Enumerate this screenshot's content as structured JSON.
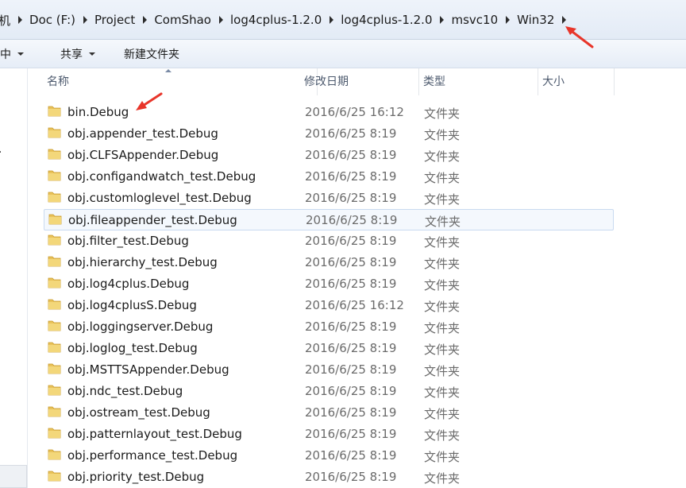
{
  "breadcrumb": {
    "items": [
      "机",
      "Doc (F:)",
      "Project",
      "ComShao",
      "log4cplus-1.2.0",
      "log4cplus-1.2.0",
      "msvc10",
      "Win32"
    ]
  },
  "toolbar": {
    "organize_label": "中",
    "share_label": "共享",
    "new_folder_label": "新建文件夹"
  },
  "columns": {
    "name": "名称",
    "date": "修改日期",
    "type": "类型",
    "size": "大小"
  },
  "files": [
    {
      "name": "bin.Debug",
      "date": "2016/6/25 16:12",
      "type": "文件夹"
    },
    {
      "name": "obj.appender_test.Debug",
      "date": "2016/6/25 8:19",
      "type": "文件夹"
    },
    {
      "name": "obj.CLFSAppender.Debug",
      "date": "2016/6/25 8:19",
      "type": "文件夹"
    },
    {
      "name": "obj.configandwatch_test.Debug",
      "date": "2016/6/25 8:19",
      "type": "文件夹"
    },
    {
      "name": "obj.customloglevel_test.Debug",
      "date": "2016/6/25 8:19",
      "type": "文件夹"
    },
    {
      "name": "obj.fileappender_test.Debug",
      "date": "2016/6/25 8:19",
      "type": "文件夹"
    },
    {
      "name": "obj.filter_test.Debug",
      "date": "2016/6/25 8:19",
      "type": "文件夹"
    },
    {
      "name": "obj.hierarchy_test.Debug",
      "date": "2016/6/25 8:19",
      "type": "文件夹"
    },
    {
      "name": "obj.log4cplus.Debug",
      "date": "2016/6/25 8:19",
      "type": "文件夹"
    },
    {
      "name": "obj.log4cplusS.Debug",
      "date": "2016/6/25 16:12",
      "type": "文件夹"
    },
    {
      "name": "obj.loggingserver.Debug",
      "date": "2016/6/25 8:19",
      "type": "文件夹"
    },
    {
      "name": "obj.loglog_test.Debug",
      "date": "2016/6/25 8:19",
      "type": "文件夹"
    },
    {
      "name": "obj.MSTTSAppender.Debug",
      "date": "2016/6/25 8:19",
      "type": "文件夹"
    },
    {
      "name": "obj.ndc_test.Debug",
      "date": "2016/6/25 8:19",
      "type": "文件夹"
    },
    {
      "name": "obj.ostream_test.Debug",
      "date": "2016/6/25 8:19",
      "type": "文件夹"
    },
    {
      "name": "obj.patternlayout_test.Debug",
      "date": "2016/6/25 8:19",
      "type": "文件夹"
    },
    {
      "name": "obj.performance_test.Debug",
      "date": "2016/6/25 8:19",
      "type": "文件夹"
    },
    {
      "name": "obj.priority_test.Debug",
      "date": "2016/6/25 8:19",
      "type": "文件夹"
    }
  ],
  "hovered_row": 5,
  "colors": {
    "annotation_arrow": "#e8352a",
    "folder": "#e9c25a",
    "hover_border": "#c9daf0"
  },
  "icons": {
    "folder": "folder-icon",
    "separator": "chevron-right-icon",
    "dropdown": "caret-down-icon",
    "sort": "sort-ascending-icon"
  }
}
